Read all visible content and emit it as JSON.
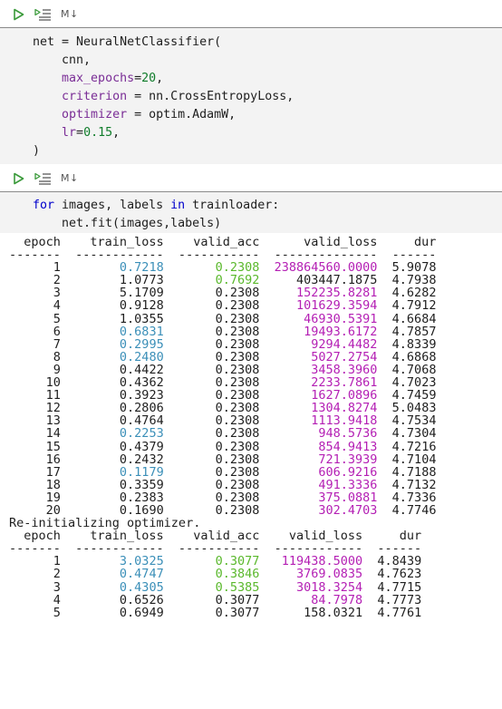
{
  "cell1": {
    "toolbar": {
      "md_label": "M↓"
    },
    "code": [
      "net = NeuralNetClassifier(",
      "    cnn,",
      "    max_epochs=20,",
      "    criterion = nn.CrossEntropyLoss,",
      "    optimizer = optim.AdamW,",
      "    lr=0.15,",
      ")"
    ]
  },
  "cell2": {
    "toolbar": {
      "md_label": "M↓"
    },
    "code": [
      "for images, labels in trainloader:",
      "    net.fit(images,labels)"
    ]
  },
  "output": {
    "table1": {
      "header": "  epoch    train_loss    valid_acc      valid_loss     dur",
      "separator": "-------  ------------  -----------  --------------  ------",
      "rows": [
        {
          "epoch": "1",
          "train_loss": "0.7218",
          "valid_acc": "0.2308",
          "valid_loss": "238864560.0000",
          "dur": "5.9078",
          "tl": "blue",
          "va": "green",
          "vl": "magenta"
        },
        {
          "epoch": "2",
          "train_loss": "1.0773",
          "valid_acc": "0.7692",
          "valid_loss": "403447.1875",
          "dur": "4.7938",
          "tl": "",
          "va": "green",
          "vl": ""
        },
        {
          "epoch": "3",
          "train_loss": "5.1709",
          "valid_acc": "0.2308",
          "valid_loss": "152235.8281",
          "dur": "4.6282",
          "tl": "",
          "va": "",
          "vl": "magenta"
        },
        {
          "epoch": "4",
          "train_loss": "0.9128",
          "valid_acc": "0.2308",
          "valid_loss": "101629.3594",
          "dur": "4.7912",
          "tl": "",
          "va": "",
          "vl": "magenta"
        },
        {
          "epoch": "5",
          "train_loss": "1.0355",
          "valid_acc": "0.2308",
          "valid_loss": "46930.5391",
          "dur": "4.6684",
          "tl": "",
          "va": "",
          "vl": "magenta"
        },
        {
          "epoch": "6",
          "train_loss": "0.6831",
          "valid_acc": "0.2308",
          "valid_loss": "19493.6172",
          "dur": "4.7857",
          "tl": "blue",
          "va": "",
          "vl": "magenta"
        },
        {
          "epoch": "7",
          "train_loss": "0.2995",
          "valid_acc": "0.2308",
          "valid_loss": "9294.4482",
          "dur": "4.8339",
          "tl": "blue",
          "va": "",
          "vl": "magenta"
        },
        {
          "epoch": "8",
          "train_loss": "0.2480",
          "valid_acc": "0.2308",
          "valid_loss": "5027.2754",
          "dur": "4.6868",
          "tl": "blue",
          "va": "",
          "vl": "magenta"
        },
        {
          "epoch": "9",
          "train_loss": "0.4422",
          "valid_acc": "0.2308",
          "valid_loss": "3458.3960",
          "dur": "4.7068",
          "tl": "",
          "va": "",
          "vl": "magenta"
        },
        {
          "epoch": "10",
          "train_loss": "0.4362",
          "valid_acc": "0.2308",
          "valid_loss": "2233.7861",
          "dur": "4.7023",
          "tl": "",
          "va": "",
          "vl": "magenta"
        },
        {
          "epoch": "11",
          "train_loss": "0.3923",
          "valid_acc": "0.2308",
          "valid_loss": "1627.0896",
          "dur": "4.7459",
          "tl": "",
          "va": "",
          "vl": "magenta"
        },
        {
          "epoch": "12",
          "train_loss": "0.2806",
          "valid_acc": "0.2308",
          "valid_loss": "1304.8274",
          "dur": "5.0483",
          "tl": "",
          "va": "",
          "vl": "magenta"
        },
        {
          "epoch": "13",
          "train_loss": "0.4764",
          "valid_acc": "0.2308",
          "valid_loss": "1113.9418",
          "dur": "4.7534",
          "tl": "",
          "va": "",
          "vl": "magenta"
        },
        {
          "epoch": "14",
          "train_loss": "0.2253",
          "valid_acc": "0.2308",
          "valid_loss": "948.5736",
          "dur": "4.7304",
          "tl": "blue",
          "va": "",
          "vl": "magenta"
        },
        {
          "epoch": "15",
          "train_loss": "0.4379",
          "valid_acc": "0.2308",
          "valid_loss": "854.9413",
          "dur": "4.7216",
          "tl": "",
          "va": "",
          "vl": "magenta"
        },
        {
          "epoch": "16",
          "train_loss": "0.2432",
          "valid_acc": "0.2308",
          "valid_loss": "721.3939",
          "dur": "4.7104",
          "tl": "",
          "va": "",
          "vl": "magenta"
        },
        {
          "epoch": "17",
          "train_loss": "0.1179",
          "valid_acc": "0.2308",
          "valid_loss": "606.9216",
          "dur": "4.7188",
          "tl": "blue",
          "va": "",
          "vl": "magenta"
        },
        {
          "epoch": "18",
          "train_loss": "0.3359",
          "valid_acc": "0.2308",
          "valid_loss": "491.3336",
          "dur": "4.7132",
          "tl": "",
          "va": "",
          "vl": "magenta"
        },
        {
          "epoch": "19",
          "train_loss": "0.2383",
          "valid_acc": "0.2308",
          "valid_loss": "375.0881",
          "dur": "4.7336",
          "tl": "",
          "va": "",
          "vl": "magenta"
        },
        {
          "epoch": "20",
          "train_loss": "0.1690",
          "valid_acc": "0.2308",
          "valid_loss": "302.4703",
          "dur": "4.7746",
          "tl": "",
          "va": "",
          "vl": "magenta"
        }
      ]
    },
    "reinit_message": "Re-initializing optimizer.",
    "table2": {
      "header": "  epoch    train_loss    valid_acc    valid_loss     dur",
      "separator": "-------  ------------  -----------  ------------  ------",
      "rows": [
        {
          "epoch": "1",
          "train_loss": "3.0325",
          "valid_acc": "0.3077",
          "valid_loss": "119438.5000",
          "dur": "4.8439",
          "tl": "blue",
          "va": "green",
          "vl": "magenta"
        },
        {
          "epoch": "2",
          "train_loss": "0.4747",
          "valid_acc": "0.3846",
          "valid_loss": "3769.0835",
          "dur": "4.7623",
          "tl": "blue",
          "va": "green",
          "vl": "magenta"
        },
        {
          "epoch": "3",
          "train_loss": "0.4305",
          "valid_acc": "0.5385",
          "valid_loss": "3018.3254",
          "dur": "4.7715",
          "tl": "blue",
          "va": "green",
          "vl": "magenta"
        },
        {
          "epoch": "4",
          "train_loss": "0.6526",
          "valid_acc": "0.3077",
          "valid_loss": "84.7978",
          "dur": "4.7773",
          "tl": "",
          "va": "",
          "vl": "magenta"
        },
        {
          "epoch": "5",
          "train_loss": "0.6949",
          "valid_acc": "0.3077",
          "valid_loss": "158.0321",
          "dur": "4.7761",
          "tl": "",
          "va": "",
          "vl": ""
        }
      ]
    }
  },
  "colors": {
    "best_train_loss": "#3b8fb8",
    "best_valid_acc": "#5ab82c",
    "best_valid_loss": "#b41fb4"
  }
}
